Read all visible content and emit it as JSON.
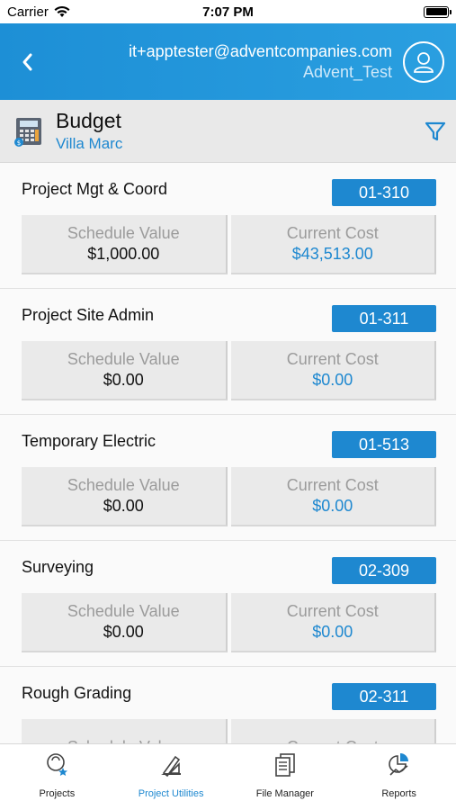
{
  "status": {
    "carrier": "Carrier",
    "time": "7:07 PM"
  },
  "header": {
    "email": "it+apptester@adventcompanies.com",
    "username": "Advent_Test"
  },
  "page": {
    "title": "Budget",
    "subtitle": "Villa Marc"
  },
  "labels": {
    "schedule_value": "Schedule Value",
    "current_cost": "Current Cost"
  },
  "items": [
    {
      "name": "Project Mgt & Coord",
      "code": "01-310",
      "schedule_value": "$1,000.00",
      "current_cost": "$43,513.00"
    },
    {
      "name": "Project Site Admin",
      "code": "01-311",
      "schedule_value": "$0.00",
      "current_cost": "$0.00"
    },
    {
      "name": "Temporary Electric",
      "code": "01-513",
      "schedule_value": "$0.00",
      "current_cost": "$0.00"
    },
    {
      "name": "Surveying",
      "code": "02-309",
      "schedule_value": "$0.00",
      "current_cost": "$0.00"
    },
    {
      "name": "Rough Grading",
      "code": "02-311",
      "schedule_value": "",
      "current_cost": ""
    }
  ],
  "tabs": [
    {
      "label": "Projects",
      "icon": "projects-icon"
    },
    {
      "label": "Project Utilities",
      "icon": "project-utilities-icon"
    },
    {
      "label": "File Manager",
      "icon": "file-manager-icon"
    },
    {
      "label": "Reports",
      "icon": "reports-icon"
    }
  ],
  "colors": {
    "accent": "#1e88d0",
    "header": "#2196e0"
  }
}
